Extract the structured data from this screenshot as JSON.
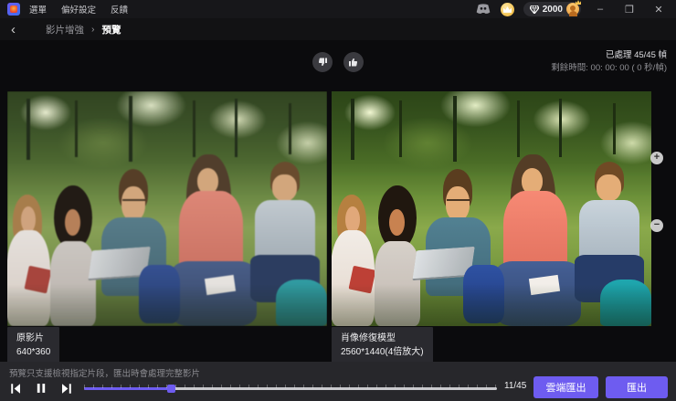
{
  "titlebar": {
    "menus": [
      {
        "label": "選單"
      },
      {
        "label": "偏好設定"
      },
      {
        "label": "反饋"
      }
    ],
    "coins": "2000"
  },
  "window_controls": {
    "minimize": "–",
    "maximize": "❒",
    "close": "✕"
  },
  "breadcrumb": {
    "back_icon": "‹",
    "parent": "影片增強",
    "separator": "›",
    "current": "預覽"
  },
  "status": {
    "processed": "已處理 45/45 幀",
    "remaining": "剩餘時間: 00: 00: 00 ( 0 秒/幀)"
  },
  "previews": {
    "original": {
      "title": "原影片",
      "resolution": "640*360"
    },
    "enhanced": {
      "title": "肖像修復模型",
      "resolution": "2560*1440(4倍放大)"
    }
  },
  "zoom_controls": {
    "zoom_in": "+",
    "zoom_out": "−"
  },
  "player": {
    "notice": "預覽只支援檢視指定片段，匯出時會處理完整影片",
    "frame_counter": "11/45",
    "current_frame": 11,
    "total_frames": 45,
    "progress_percent": 21
  },
  "actions": {
    "cloud_export": "雲端匯出",
    "export": "匯出"
  },
  "colors": {
    "accent": "#6e5cf0",
    "vip_gold": "#f2c14e"
  }
}
